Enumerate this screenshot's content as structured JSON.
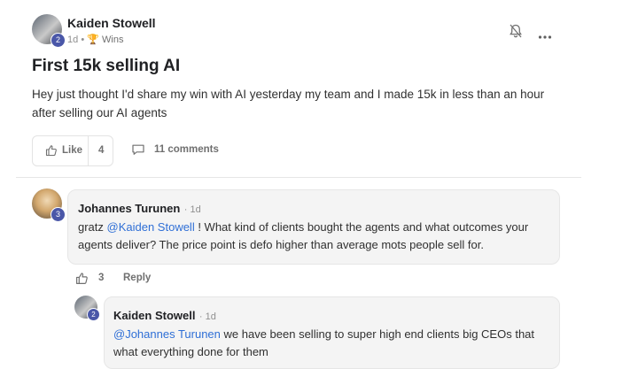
{
  "post": {
    "author": "Kaiden Stowell",
    "author_level": "2",
    "time": "1d",
    "sep": "•",
    "category": "Wins",
    "title": "First 15k selling AI",
    "body": "Hey just thought I'd share my win with AI yesterday my team and I made 15k in less than an hour after selling our AI agents",
    "like_label": "Like",
    "like_count": "4",
    "comments_label": "11 comments"
  },
  "comments": [
    {
      "author": "Johannes Turunen",
      "level": "3",
      "time": "· 1d",
      "prefix": "gratz ",
      "mention": "@Kaiden Stowell",
      "text": " ! What kind of clients bought the agents and what outcomes your agents deliver? The price point is defo higher than average mots people sell for.",
      "like_count": "3",
      "reply_label": "Reply"
    },
    {
      "author": "Kaiden Stowell",
      "level": "2",
      "time": "· 1d",
      "mention": "@Johannes Turunen",
      "text": " we have been selling to super high end clients big CEOs that what everything done for them"
    }
  ],
  "icons": {
    "bell": "bell-off-icon",
    "more": "more-horizontal-icon",
    "like": "thumbs-up-icon",
    "comment": "comment-bubble-icon",
    "trophy": "trophy-icon"
  }
}
